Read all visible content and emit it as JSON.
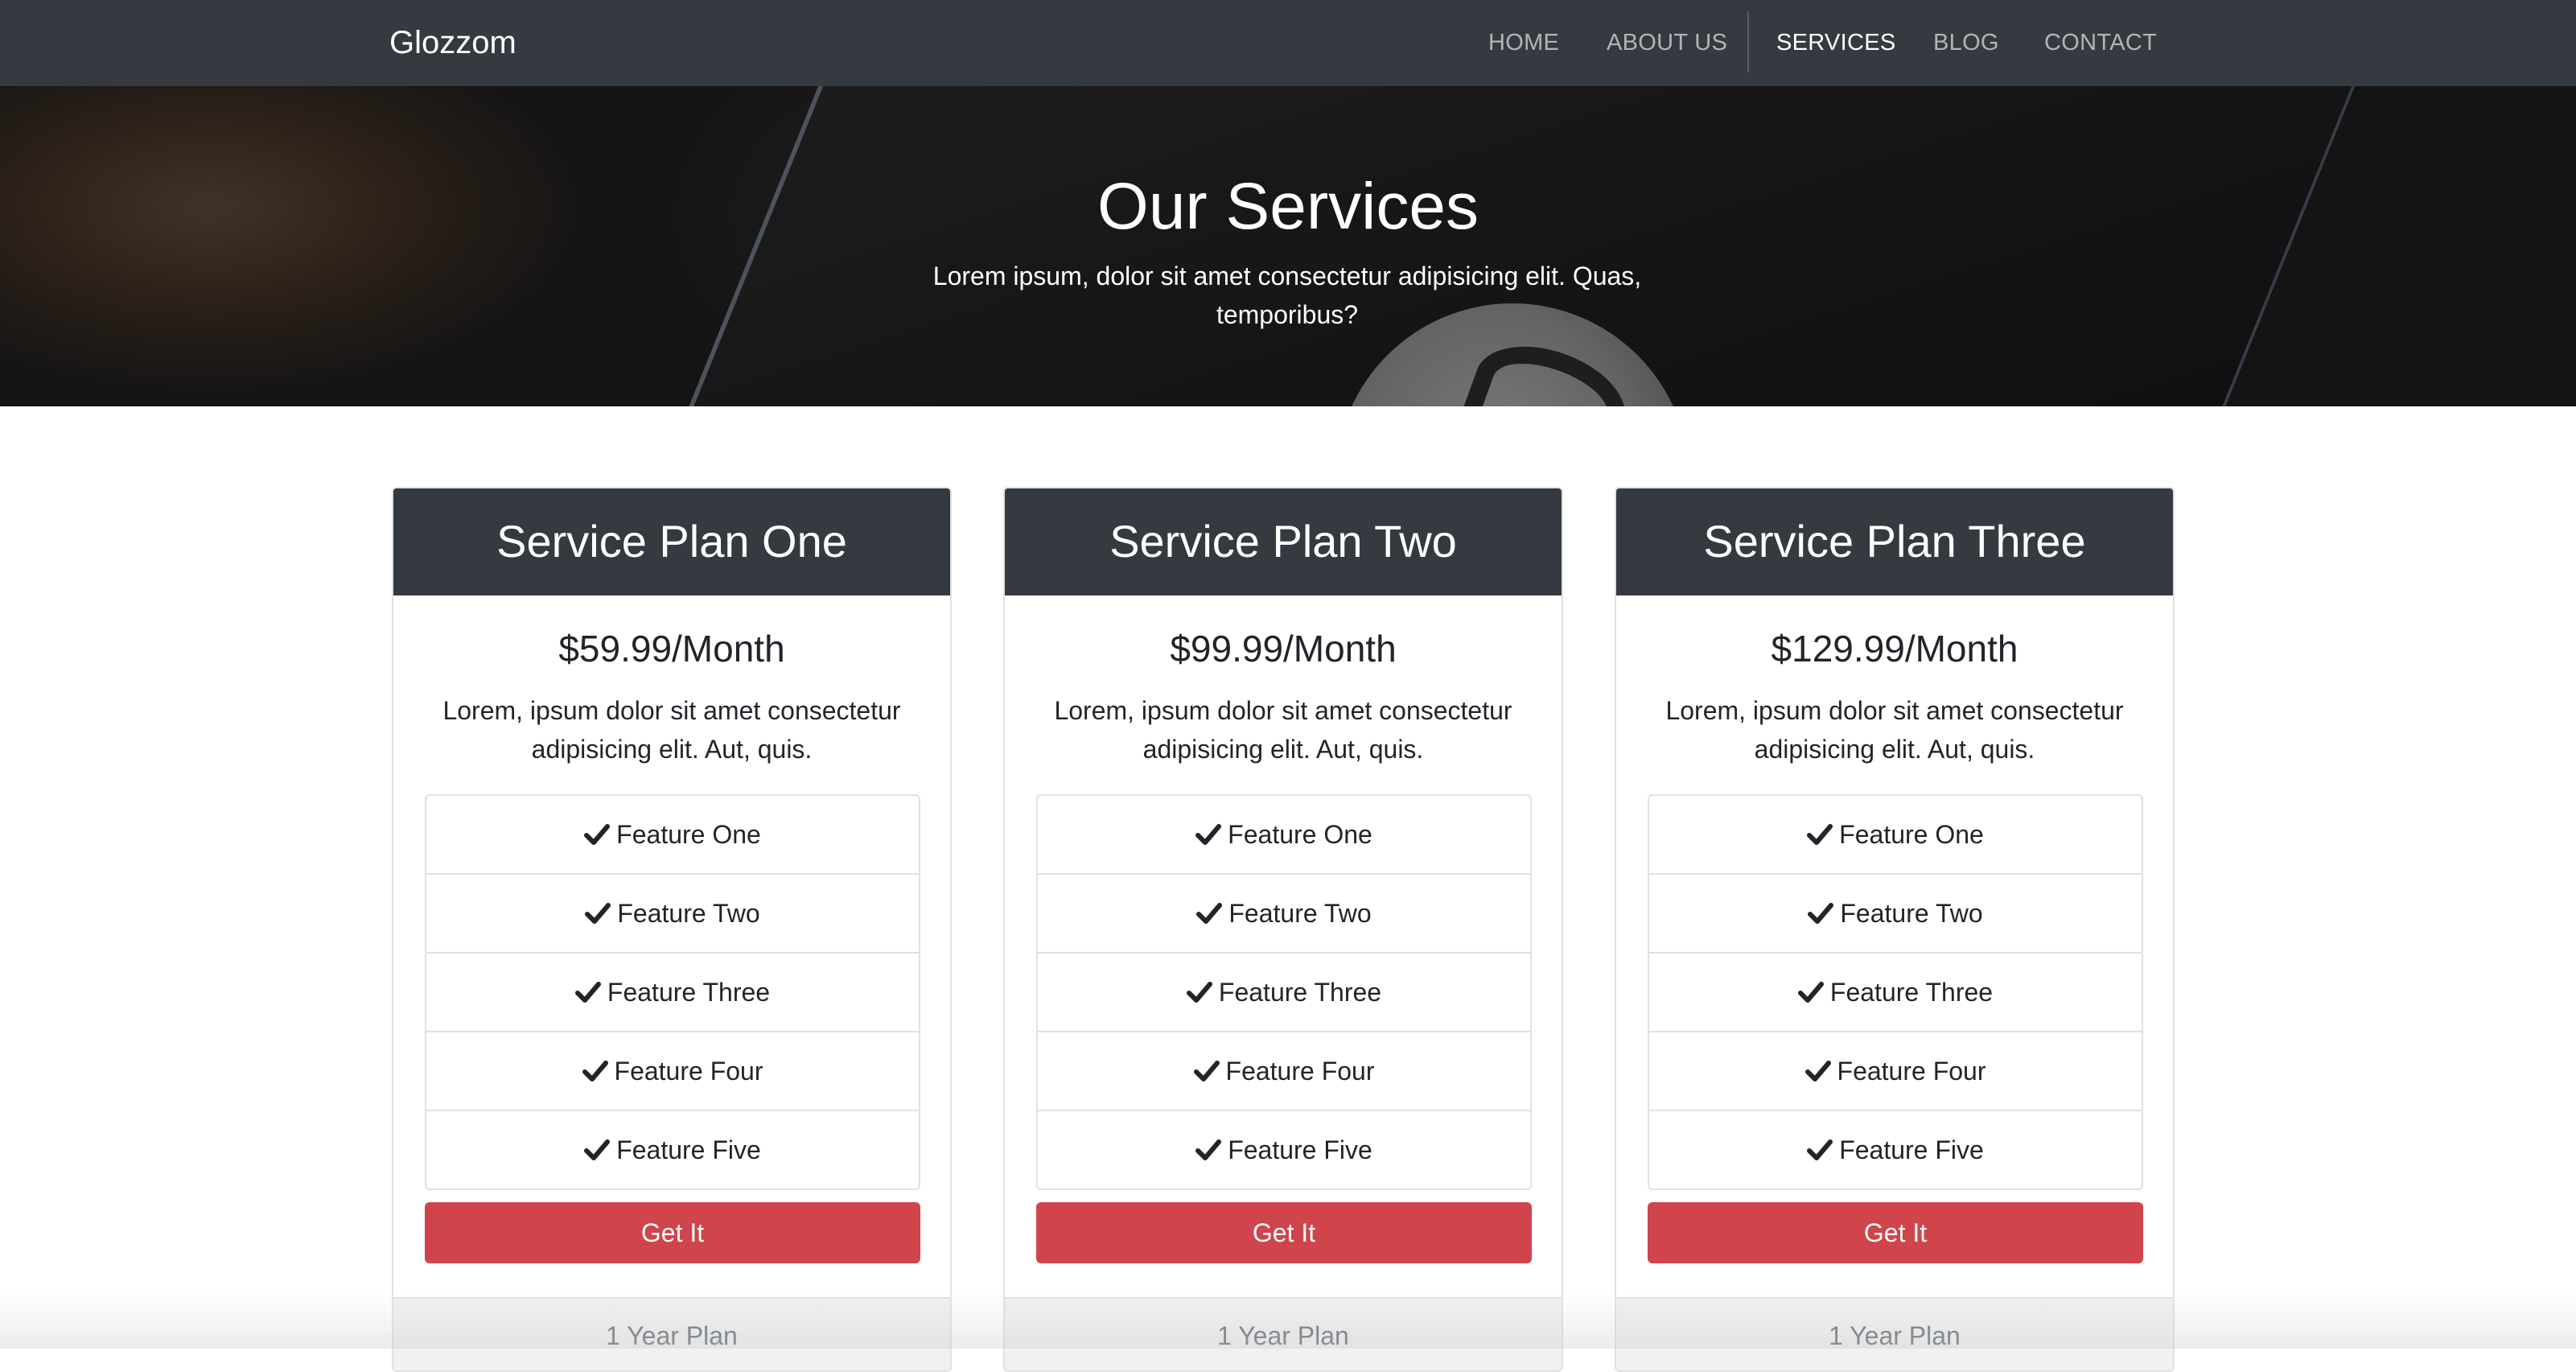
{
  "navbar": {
    "brand": "Glozzom",
    "links": [
      {
        "label": "HOME",
        "active": false
      },
      {
        "label": "ABOUT US",
        "active": false
      },
      {
        "label": "SERVICES",
        "active": true
      },
      {
        "label": "BLOG",
        "active": false
      },
      {
        "label": "CONTACT",
        "active": false
      }
    ]
  },
  "hero": {
    "title": "Our Services",
    "text": "Lorem ipsum, dolor sit amet consectetur adipisicing elit. Quas, temporibus?"
  },
  "plans": [
    {
      "title": "Service Plan One",
      "price": "$59.99/Month",
      "description": "Lorem, ipsum dolor sit amet consectetur adipisicing elit. Aut, quis.",
      "features": [
        "Feature One",
        "Feature Two",
        "Feature Three",
        "Feature Four",
        "Feature Five"
      ],
      "button": "Get It",
      "footer": "1 Year Plan"
    },
    {
      "title": "Service Plan Two",
      "price": "$99.99/Month",
      "description": "Lorem, ipsum dolor sit amet consectetur adipisicing elit. Aut, quis.",
      "features": [
        "Feature One",
        "Feature Two",
        "Feature Three",
        "Feature Four",
        "Feature Five"
      ],
      "button": "Get It",
      "footer": "1 Year Plan"
    },
    {
      "title": "Service Plan Three",
      "price": "$129.99/Month",
      "description": "Lorem, ipsum dolor sit amet consectetur adipisicing elit. Aut, quis.",
      "features": [
        "Feature One",
        "Feature Two",
        "Feature Three",
        "Feature Four",
        "Feature Five"
      ],
      "button": "Get It",
      "footer": "1 Year Plan"
    }
  ],
  "icons": {
    "feature_check": "check-icon"
  },
  "colors": {
    "navbar_bg": "#343a40",
    "button_red": "#d0444b",
    "card_header_bg": "#343a40",
    "footer_bg": "#f1f1f1"
  }
}
